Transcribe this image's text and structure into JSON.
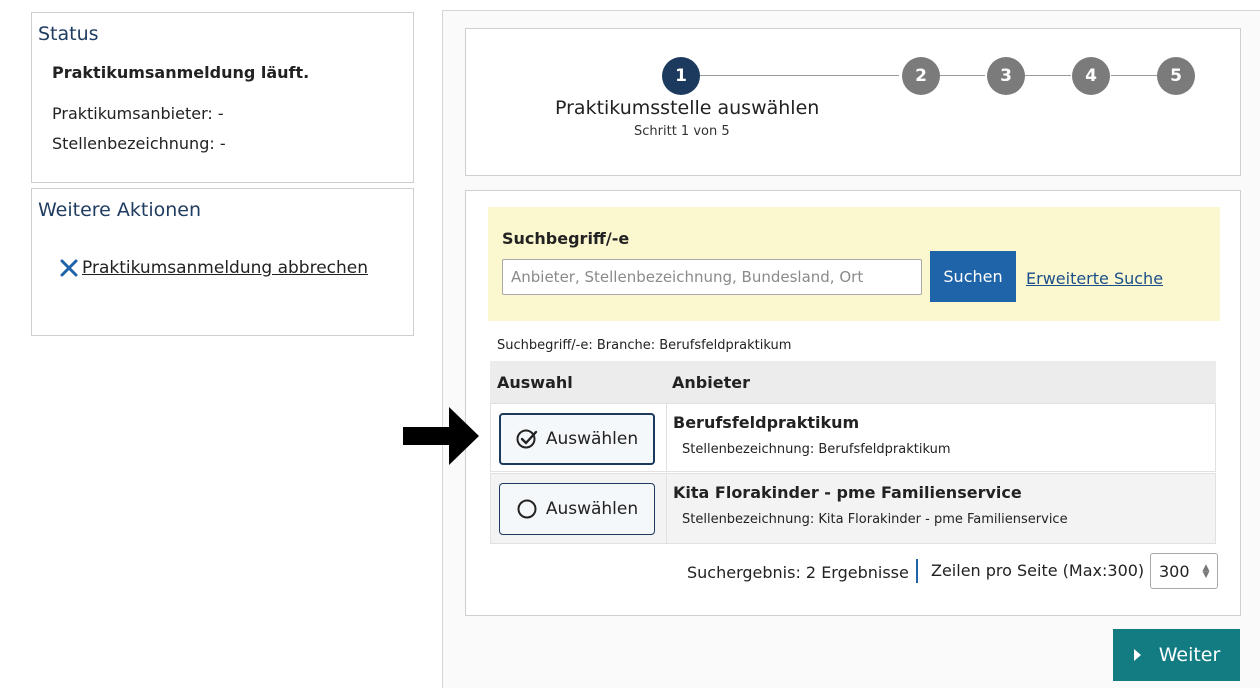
{
  "status": {
    "title": "Status",
    "headline": "Praktikumsanmeldung läuft.",
    "provider_line": "Praktikumsanbieter: -",
    "position_line": "Stellenbezeichnung: -"
  },
  "actions": {
    "title": "Weitere Aktionen",
    "cancel_label": "Praktikumsanmeldung abbrechen"
  },
  "stepper": {
    "steps": [
      "1",
      "2",
      "3",
      "4",
      "5"
    ],
    "active_step": 1,
    "title": "Praktikumsstelle auswählen",
    "subtitle": "Schritt 1 von 5"
  },
  "search": {
    "label": "Suchbegriff/-e",
    "placeholder": "Anbieter, Stellenbezeichnung, Bundesland, Ort",
    "value": "",
    "button_label": "Suchen",
    "advanced_label": "Erweiterte Suche",
    "filter_text": "Suchbegriff/-e: Branche: Berufsfeldpraktikum"
  },
  "table": {
    "headers": [
      "Auswahl",
      "Anbieter"
    ],
    "rows": [
      {
        "select_label": "Auswählen",
        "selected": true,
        "provider": "Berufsfeldpraktikum",
        "position": "Stellenbezeichnung: Berufsfeldpraktikum"
      },
      {
        "select_label": "Auswählen",
        "selected": false,
        "provider": "Kita Florakinder - pme Familienservice",
        "position": "Stellenbezeichnung: Kita Florakinder - pme Familienservice"
      }
    ]
  },
  "footer": {
    "result_count": "Suchergebnis: 2 Ergebnisse",
    "rows_label": "Zeilen pro Seite (Max:300)",
    "rows_value": "300"
  },
  "next_button_label": "Weiter",
  "colors": {
    "primary": "#1c3a5e",
    "search_button": "#1f63a8",
    "next_button": "#127c82",
    "search_background": "#fbf7cf",
    "step_inactive": "#7b7b7b"
  }
}
